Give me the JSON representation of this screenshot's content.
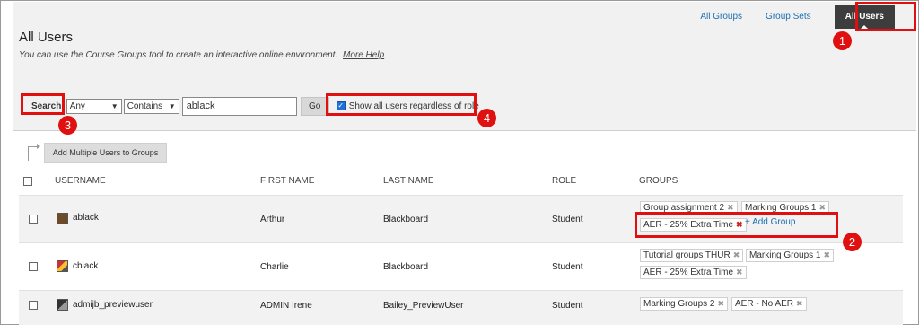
{
  "nav": {
    "all_groups": "All Groups",
    "group_sets": "Group Sets",
    "all_users": "All Users"
  },
  "page": {
    "title": "All Users",
    "description": "You can use the Course Groups tool to create an interactive online environment.",
    "help_link": "More Help"
  },
  "search": {
    "label": "Search:",
    "field_select": "Any",
    "operator_select": "Contains",
    "query": "ablack",
    "go_label": "Go",
    "show_all_label": "Show all users regardless of role"
  },
  "toolbar": {
    "add_multiple": "Add Multiple Users to Groups"
  },
  "table": {
    "headers": {
      "username": "USERNAME",
      "first_name": "FIRST NAME",
      "last_name": "LAST NAME",
      "role": "ROLE",
      "groups": "GROUPS"
    },
    "add_group_label": "+ Add Group",
    "rows": [
      {
        "username": "ablack",
        "first_name": "Arthur",
        "last_name": "Blackboard",
        "role": "Student",
        "groups": [
          "Group assignment 2",
          "Marking Groups 1",
          "AER - 25% Extra Time"
        ]
      },
      {
        "username": "cblack",
        "first_name": "Charlie",
        "last_name": "Blackboard",
        "role": "Student",
        "groups": [
          "Tutorial groups THUR",
          "Marking Groups 1",
          "AER - 25% Extra Time"
        ]
      },
      {
        "username": "admijb_previewuser",
        "first_name": "ADMIN Irene",
        "last_name": "Bailey_PreviewUser",
        "role": "Student",
        "groups": [
          "Marking Groups 2",
          "AER - No AER"
        ]
      }
    ]
  },
  "annotations": {
    "n1": "1",
    "n2": "2",
    "n3": "3",
    "n4": "4"
  },
  "colors": {
    "highlight": "#e01010",
    "link": "#1a6fb0",
    "active_tab": "#3d3d3d"
  }
}
